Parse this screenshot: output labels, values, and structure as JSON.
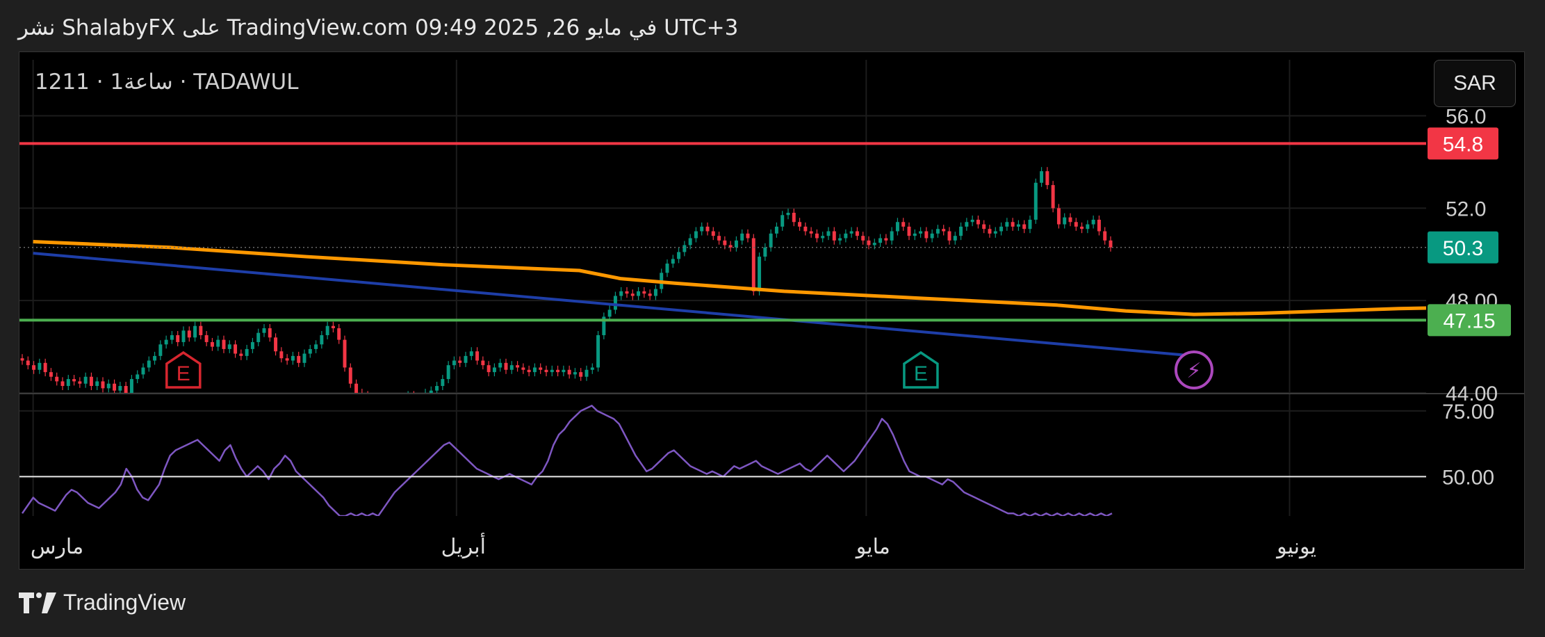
{
  "header": {
    "published": "نشر ShalabyFX على TradingView.com 09:49 2025 ,26 في مايو UTC+3"
  },
  "symbol": {
    "line": "1211 · 1ساعة · TADAWUL"
  },
  "currency_button": "SAR",
  "footer": {
    "brand": "TradingView"
  },
  "colors": {
    "resistance": "#f23645",
    "support": "#4caf50",
    "last_price": "#089981",
    "ma_orange": "#ff9800",
    "trend_blue": "#1e3ea8",
    "rsi": "#7e57c2",
    "candle_up": "#089981",
    "candle_down": "#f23645",
    "earnings_past": "#d7262f",
    "earnings_future": "#089981",
    "dividend": "#ab47bc"
  },
  "icons": [
    "earnings-icon",
    "earnings-icon",
    "dividend-lightning-icon",
    "tradingview-logo-icon"
  ],
  "chart_data": {
    "type": "candlestick",
    "price_pane": {
      "ylim": [
        44.0,
        57.4
      ],
      "y_ticks": [
        "56.0",
        "52.0",
        "48.00",
        "44.00"
      ],
      "horizontal_lines": [
        {
          "name": "resistance",
          "value": 54.8,
          "label": "54.8"
        },
        {
          "name": "support",
          "value": 47.15,
          "label": "47.15"
        }
      ],
      "last_price": {
        "value": 50.3,
        "label": "50.3"
      },
      "moving_average_orange": {
        "x_day": [
          0,
          10,
          20,
          30,
          40,
          43,
          47,
          55,
          65,
          75,
          80,
          85,
          90,
          95,
          100,
          108
        ],
        "y": [
          50.55,
          50.3,
          49.9,
          49.55,
          49.3,
          48.95,
          48.75,
          48.4,
          48.1,
          47.8,
          47.55,
          47.4,
          47.45,
          47.55,
          47.65,
          47.75
        ]
      },
      "trend_line_blue": {
        "x_day": [
          0,
          86
        ],
        "y": [
          50.05,
          45.55
        ]
      },
      "closes": [
        45.4,
        45.2,
        45.0,
        45.3,
        44.9,
        44.7,
        44.5,
        44.3,
        44.6,
        44.5,
        44.4,
        44.7,
        44.3,
        44.5,
        44.2,
        44.4,
        44.1,
        44.3,
        44.0,
        44.6,
        44.8,
        45.1,
        45.4,
        45.6,
        46.1,
        46.3,
        46.5,
        46.2,
        46.7,
        46.4,
        46.9,
        46.5,
        46.2,
        46.0,
        46.3,
        45.9,
        46.1,
        45.7,
        45.6,
        45.9,
        46.2,
        46.6,
        46.8,
        46.4,
        45.8,
        45.5,
        45.4,
        45.6,
        45.3,
        45.7,
        45.9,
        46.1,
        46.5,
        46.9,
        46.8,
        46.3,
        45.1,
        44.4,
        44.0,
        43.9,
        43.8,
        43.7,
        43.8,
        43.7,
        43.8,
        43.7,
        43.8,
        43.9,
        43.8,
        43.7,
        44.0,
        44.1,
        44.3,
        44.6,
        45.2,
        45.4,
        45.3,
        45.6,
        45.8,
        45.4,
        45.2,
        44.9,
        45.1,
        45.3,
        45.0,
        45.2,
        45.1,
        45.0,
        44.9,
        45.1,
        45.0,
        44.9,
        45.0,
        44.9,
        45.0,
        44.8,
        44.9,
        44.7,
        45.0,
        45.1,
        46.5,
        47.3,
        47.6,
        48.2,
        48.4,
        48.3,
        48.2,
        48.4,
        48.3,
        48.2,
        48.5,
        49.2,
        49.6,
        49.8,
        50.1,
        50.4,
        50.7,
        51.0,
        51.2,
        51.0,
        50.8,
        50.6,
        50.4,
        50.3,
        50.6,
        50.9,
        50.7,
        48.4,
        49.9,
        50.3,
        50.9,
        51.2,
        51.7,
        51.8,
        51.4,
        51.2,
        51.0,
        50.9,
        50.7,
        50.8,
        51.0,
        50.6,
        50.7,
        50.9,
        51.0,
        50.8,
        50.6,
        50.4,
        50.5,
        50.7,
        50.6,
        51.0,
        51.4,
        51.2,
        50.8,
        50.9,
        51.0,
        50.7,
        50.9,
        51.1,
        51.0,
        50.6,
        50.8,
        51.2,
        51.4,
        51.5,
        51.3,
        51.1,
        50.9,
        51.0,
        51.2,
        51.4,
        51.2,
        51.3,
        51.1,
        51.5,
        53.1,
        53.6,
        53.0,
        52.0,
        51.3,
        51.6,
        51.4,
        51.2,
        51.1,
        51.3,
        51.5,
        51.0,
        50.6,
        50.3
      ]
    },
    "rsi_pane": {
      "ylim": [
        35,
        80
      ],
      "y_ticks": [
        "75.00",
        "50.00"
      ],
      "midline": 50,
      "values": [
        36,
        39,
        42,
        40,
        39,
        38,
        37,
        40,
        43,
        45,
        44,
        42,
        40,
        39,
        38,
        40,
        42,
        44,
        47,
        53,
        50,
        45,
        42,
        41,
        44,
        47,
        53,
        58,
        60,
        61,
        62,
        63,
        64,
        62,
        60,
        58,
        56,
        60,
        62,
        57,
        53,
        50,
        52,
        54,
        52,
        49,
        53,
        55,
        58,
        56,
        52,
        50,
        48,
        46,
        44,
        42,
        39,
        37,
        35,
        35,
        36,
        35,
        36,
        35,
        36,
        35,
        38,
        41,
        44,
        46,
        48,
        50,
        52,
        54,
        56,
        58,
        60,
        62,
        63,
        61,
        59,
        57,
        55,
        53,
        52,
        51,
        50,
        49,
        50,
        51,
        50,
        49,
        48,
        47,
        50,
        52,
        56,
        62,
        66,
        68,
        71,
        73,
        75,
        76,
        77,
        75,
        74,
        73,
        72,
        70,
        66,
        62,
        58,
        55,
        52,
        53,
        55,
        57,
        59,
        60,
        58,
        56,
        54,
        53,
        52,
        51,
        52,
        51,
        50,
        52,
        54,
        53,
        54,
        55,
        56,
        54,
        53,
        52,
        51,
        52,
        53,
        54,
        55,
        53,
        52,
        54,
        56,
        58,
        56,
        54,
        52,
        54,
        56,
        59,
        62,
        65,
        68,
        72,
        70,
        66,
        61,
        56,
        52,
        51,
        50,
        50,
        49,
        48,
        47,
        49,
        48,
        46,
        44,
        43,
        42,
        41,
        40,
        39,
        38,
        37,
        36,
        36,
        35,
        36,
        35,
        36,
        35,
        36,
        35,
        36,
        35,
        36,
        35,
        36,
        35,
        36,
        35,
        36,
        35,
        36
      ]
    },
    "x_axis": {
      "labels": [
        {
          "label": "مارس",
          "day": 0
        },
        {
          "label": "أبريل",
          "day": 31
        },
        {
          "label": "مايو",
          "day": 61
        },
        {
          "label": "يونيو",
          "day": 92
        }
      ],
      "visible_days": [
        -1,
        102
      ]
    },
    "events": [
      {
        "type": "earnings",
        "label": "E",
        "day": 11,
        "state": "past"
      },
      {
        "type": "earnings",
        "label": "E",
        "day": 65,
        "state": "upcoming"
      },
      {
        "type": "dividend",
        "label": "⚡",
        "day": 85
      }
    ],
    "grid": true,
    "axis_position": "right"
  }
}
